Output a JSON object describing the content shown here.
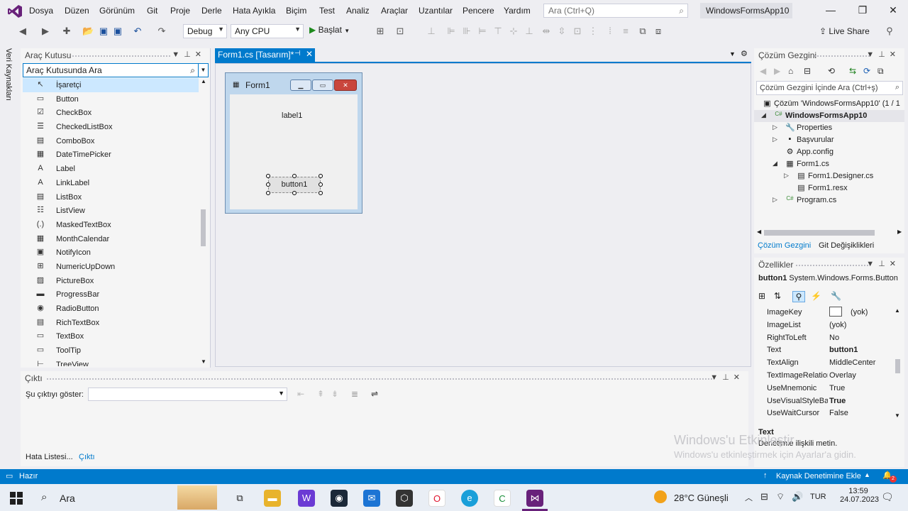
{
  "app": {
    "solution_name": "WindowsFormsApp10"
  },
  "menu": [
    "Dosya",
    "Düzen",
    "Görünüm",
    "Git",
    "Proje",
    "Derle",
    "Hata Ayıkla",
    "Biçim",
    "Test",
    "Analiz",
    "Araçlar",
    "Uzantılar",
    "Pencere",
    "Yardım"
  ],
  "search": {
    "placeholder": "Ara (Ctrl+Q)"
  },
  "toolbar": {
    "config": "Debug",
    "platform": "Any CPU",
    "start": "Başlat",
    "live_share": "Live Share"
  },
  "side_strip": {
    "label": "Veri Kaynakları"
  },
  "toolbox": {
    "title": "Araç Kutusu",
    "search_value": "Araç Kutusunda Ara",
    "items": [
      {
        "label": "İşaretçi",
        "icon": "pointer-icon",
        "selected": true
      },
      {
        "label": "Button",
        "icon": "button-icon"
      },
      {
        "label": "CheckBox",
        "icon": "checkbox-icon"
      },
      {
        "label": "CheckedListBox",
        "icon": "checkedlistbox-icon"
      },
      {
        "label": "ComboBox",
        "icon": "combobox-icon"
      },
      {
        "label": "DateTimePicker",
        "icon": "datetimepicker-icon"
      },
      {
        "label": "Label",
        "icon": "label-icon"
      },
      {
        "label": "LinkLabel",
        "icon": "linklabel-icon"
      },
      {
        "label": "ListBox",
        "icon": "listbox-icon"
      },
      {
        "label": "ListView",
        "icon": "listview-icon"
      },
      {
        "label": "MaskedTextBox",
        "icon": "maskedtextbox-icon"
      },
      {
        "label": "MonthCalendar",
        "icon": "monthcalendar-icon"
      },
      {
        "label": "NotifyIcon",
        "icon": "notifyicon-icon"
      },
      {
        "label": "NumericUpDown",
        "icon": "numericupdown-icon"
      },
      {
        "label": "PictureBox",
        "icon": "picturebox-icon"
      },
      {
        "label": "ProgressBar",
        "icon": "progressbar-icon"
      },
      {
        "label": "RadioButton",
        "icon": "radiobutton-icon"
      },
      {
        "label": "RichTextBox",
        "icon": "richtextbox-icon"
      },
      {
        "label": "TextBox",
        "icon": "textbox-icon"
      },
      {
        "label": "ToolTip",
        "icon": "tooltip-icon"
      },
      {
        "label": "TreeView",
        "icon": "treeview-icon"
      }
    ]
  },
  "document": {
    "tab_label": "Form1.cs [Tasarım]*"
  },
  "designer": {
    "form_title": "Form1",
    "label1": "label1",
    "button1": "button1"
  },
  "solution_explorer": {
    "title": "Çözüm Gezgini",
    "search_placeholder": "Çözüm Gezgini İçinde Ara (Ctrl+ş)",
    "tree": [
      {
        "label": "Çözüm 'WindowsFormsApp10' (1 / 1",
        "level": 0,
        "expander": "",
        "icon": "solution-icon",
        "bold": false,
        "selected": false
      },
      {
        "label": "WindowsFormsApp10",
        "level": 0,
        "expander": "◢",
        "icon": "csharp-project-icon",
        "bold": true,
        "selected": true
      },
      {
        "label": "Properties",
        "level": 1,
        "expander": "▷",
        "icon": "wrench-icon",
        "bold": false,
        "selected": false
      },
      {
        "label": "Başvurular",
        "level": 1,
        "expander": "▷",
        "icon": "references-icon",
        "bold": false,
        "selected": false
      },
      {
        "label": "App.config",
        "level": 1,
        "expander": "",
        "icon": "config-icon",
        "bold": false,
        "selected": false
      },
      {
        "label": "Form1.cs",
        "level": 1,
        "expander": "◢",
        "icon": "form-icon",
        "bold": false,
        "selected": false
      },
      {
        "label": "Form1.Designer.cs",
        "level": 2,
        "expander": "▷",
        "icon": "cs-file-icon",
        "bold": false,
        "selected": false
      },
      {
        "label": "Form1.resx",
        "level": 2,
        "expander": "",
        "icon": "resx-icon",
        "bold": false,
        "selected": false
      },
      {
        "label": "Program.cs",
        "level": 1,
        "expander": "▷",
        "icon": "csharp-file-icon",
        "bold": false,
        "selected": false
      }
    ],
    "tabs": [
      "Çözüm Gezgini",
      "Git Değişiklikleri"
    ]
  },
  "properties": {
    "title": "Özellikler",
    "object_name": "button1",
    "object_type": "System.Windows.Forms.Button",
    "rows": [
      {
        "name": "ImageKey",
        "value": "(yok)",
        "bold": false,
        "swatch": true
      },
      {
        "name": "ImageList",
        "value": "(yok)",
        "bold": false
      },
      {
        "name": "RightToLeft",
        "value": "No",
        "bold": false
      },
      {
        "name": "Text",
        "value": "button1",
        "bold": true
      },
      {
        "name": "TextAlign",
        "value": "MiddleCenter",
        "bold": false
      },
      {
        "name": "TextImageRelation",
        "value": "Overlay",
        "bold": false
      },
      {
        "name": "UseMnemonic",
        "value": "True",
        "bold": false
      },
      {
        "name": "UseVisualStyleBackColor",
        "value": "True",
        "bold": true
      },
      {
        "name": "UseWaitCursor",
        "value": "False",
        "bold": false
      }
    ],
    "desc_title": "Text",
    "desc_body": "Denetimle ilişkili metin."
  },
  "output": {
    "title": "Çıktı",
    "show_label": "Şu çıktıyı göster:",
    "tabs": [
      "Hata Listesi...",
      "Çıktı"
    ]
  },
  "watermark": {
    "line1": "Windows'u Etkinleştir",
    "line2": "Windows'u etkinleştirmek için Ayarlar'a gidin."
  },
  "status": {
    "left": "Hazır",
    "right": "Kaynak Denetimine Ekle",
    "notifications": "2"
  },
  "taskbar": {
    "search": "Ara",
    "weather": "28°C  Güneşli",
    "lang": "TUR",
    "time": "13:59",
    "date": "24.07.2023"
  },
  "colors": {
    "accent": "#007acc",
    "vs_purple": "#68217a",
    "selection": "#cce8ff"
  }
}
